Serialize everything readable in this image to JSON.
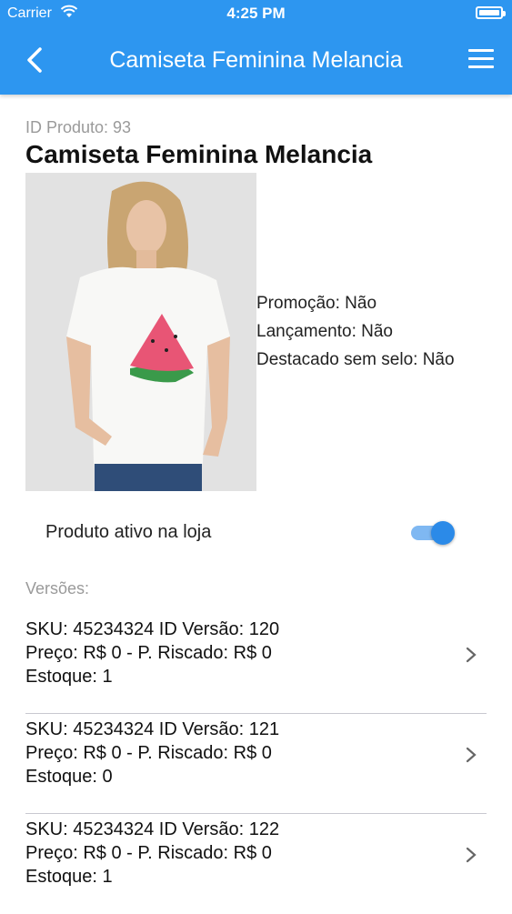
{
  "status_bar": {
    "carrier": "Carrier",
    "time": "4:25 PM"
  },
  "nav": {
    "title": "Camiseta Feminina Melancia"
  },
  "product": {
    "id_text": "ID Produto: 93",
    "name": "Camiseta Feminina Melancia",
    "promo": "Promoção: Não",
    "launch": "Lançamento: Não",
    "featured": "Destacado sem selo: Não"
  },
  "active": {
    "label": "Produto ativo na loja",
    "on": true
  },
  "versions": {
    "label": "Versões:",
    "items": [
      {
        "line1": "SKU: 45234324  ID Versão: 120",
        "line2": "Preço: R$ 0  - P. Riscado: R$ 0",
        "line3": "Estoque: 1"
      },
      {
        "line1": "SKU: 45234324  ID Versão: 121",
        "line2": "Preço: R$ 0  - P. Riscado: R$ 0",
        "line3": "Estoque: 0"
      },
      {
        "line1": "SKU: 45234324  ID Versão: 122",
        "line2": "Preço: R$ 0  - P. Riscado: R$ 0",
        "line3": "Estoque: 1"
      }
    ]
  },
  "colors": {
    "nav_bar": "#2d96f0",
    "toggle_on": "#2b8ae8",
    "muted_text": "#9a9a9a"
  },
  "icons": {
    "back": "chevron-left-icon",
    "menu": "hamburger-menu-icon",
    "row": "chevron-right-icon",
    "wifi": "wifi-icon",
    "battery": "battery-icon"
  }
}
